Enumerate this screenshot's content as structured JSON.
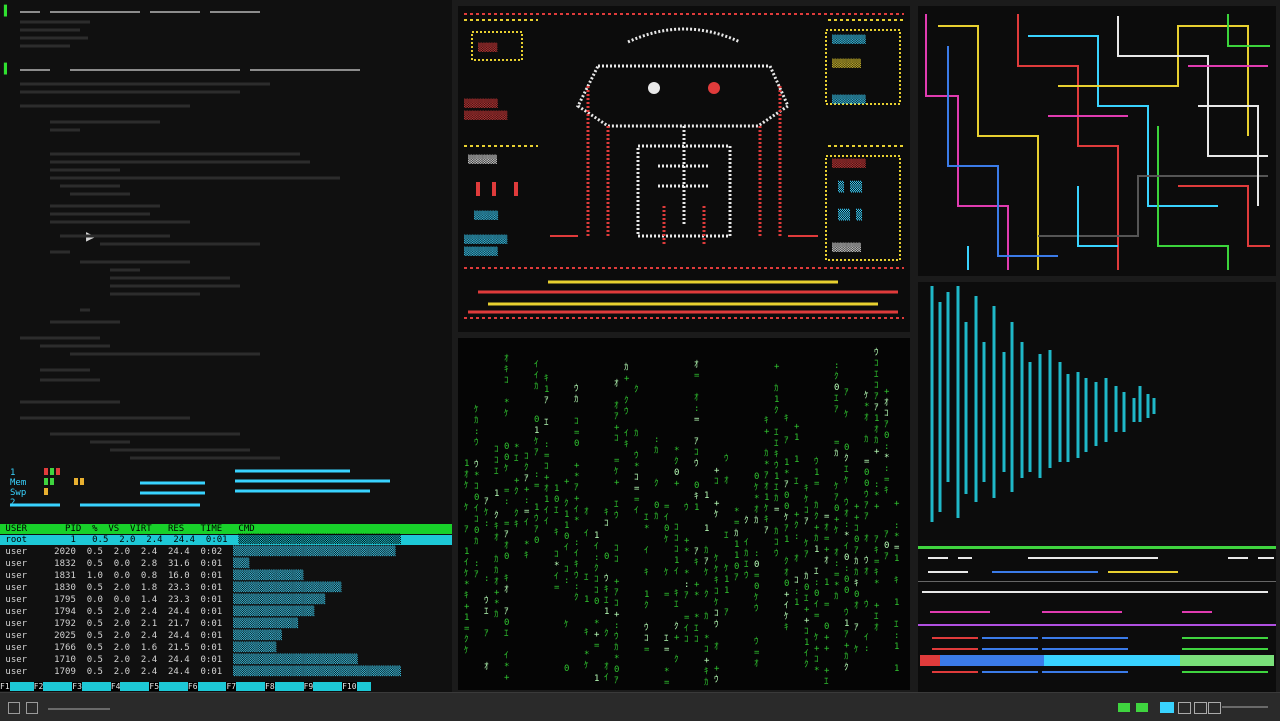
{
  "editor": {
    "cursor": "▶"
  },
  "htop": {
    "columns": [
      "USER",
      "PID",
      "%",
      "VS",
      "VIRT",
      "RES",
      "TIME",
      "CMD"
    ]
  },
  "ascii": {
    "title_line": "",
    "footer_line": ""
  },
  "player": {
    "status_lines": []
  },
  "taskbar": {
    "clock": ""
  },
  "colors": {
    "terminal_bg": "#101010",
    "htop_header": "#18d12a",
    "htop_selected": "#1dc8d6",
    "matrix_green": "#2fc42f",
    "viz_cyan": "#1fb8c8"
  },
  "icons": [
    "menu-icon",
    "terminal-icon",
    "network-icon",
    "volume-icon",
    "battery-icon"
  ]
}
